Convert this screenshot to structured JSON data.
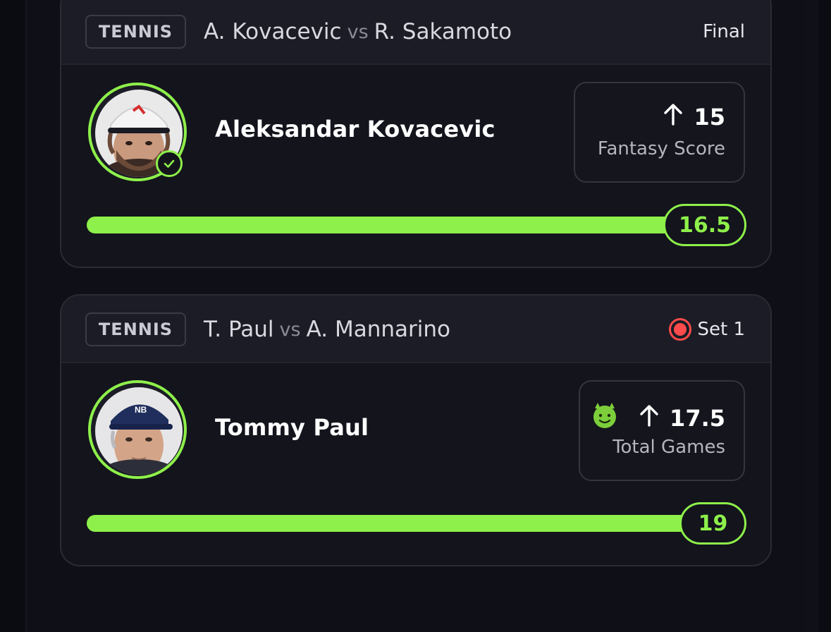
{
  "colors": {
    "accent": "#8ef04a",
    "live": "#ff4b4b",
    "background": "#0f1017",
    "card": "#13141c"
  },
  "cards": [
    {
      "sport": "TENNIS",
      "matchup": {
        "player_a": "A. Kovacevic",
        "vs": "vs",
        "player_b": "R. Sakamoto"
      },
      "status": "Final",
      "status_icon": null,
      "player_name": "Aleksandar Kovacevic",
      "avatar_icon": "player-photo-kovacevic",
      "badge_icon": "check-circle-icon",
      "stat": {
        "direction_icon": "arrow-up-icon",
        "line": "15",
        "label": "Fantasy Score",
        "modifier_icon": null
      },
      "result": "16.5",
      "progress_fraction": 1.0
    },
    {
      "sport": "TENNIS",
      "matchup": {
        "player_a": "T. Paul",
        "vs": "vs",
        "player_b": "A. Mannarino"
      },
      "status": "Set 1",
      "status_icon": "live-record-icon",
      "player_name": "Tommy Paul",
      "avatar_icon": "player-photo-paul",
      "badge_icon": null,
      "stat": {
        "direction_icon": "arrow-up-icon",
        "line": "17.5",
        "label": "Total Games",
        "modifier_icon": "devil-emoji-icon"
      },
      "result": "19",
      "progress_fraction": 1.0
    }
  ]
}
